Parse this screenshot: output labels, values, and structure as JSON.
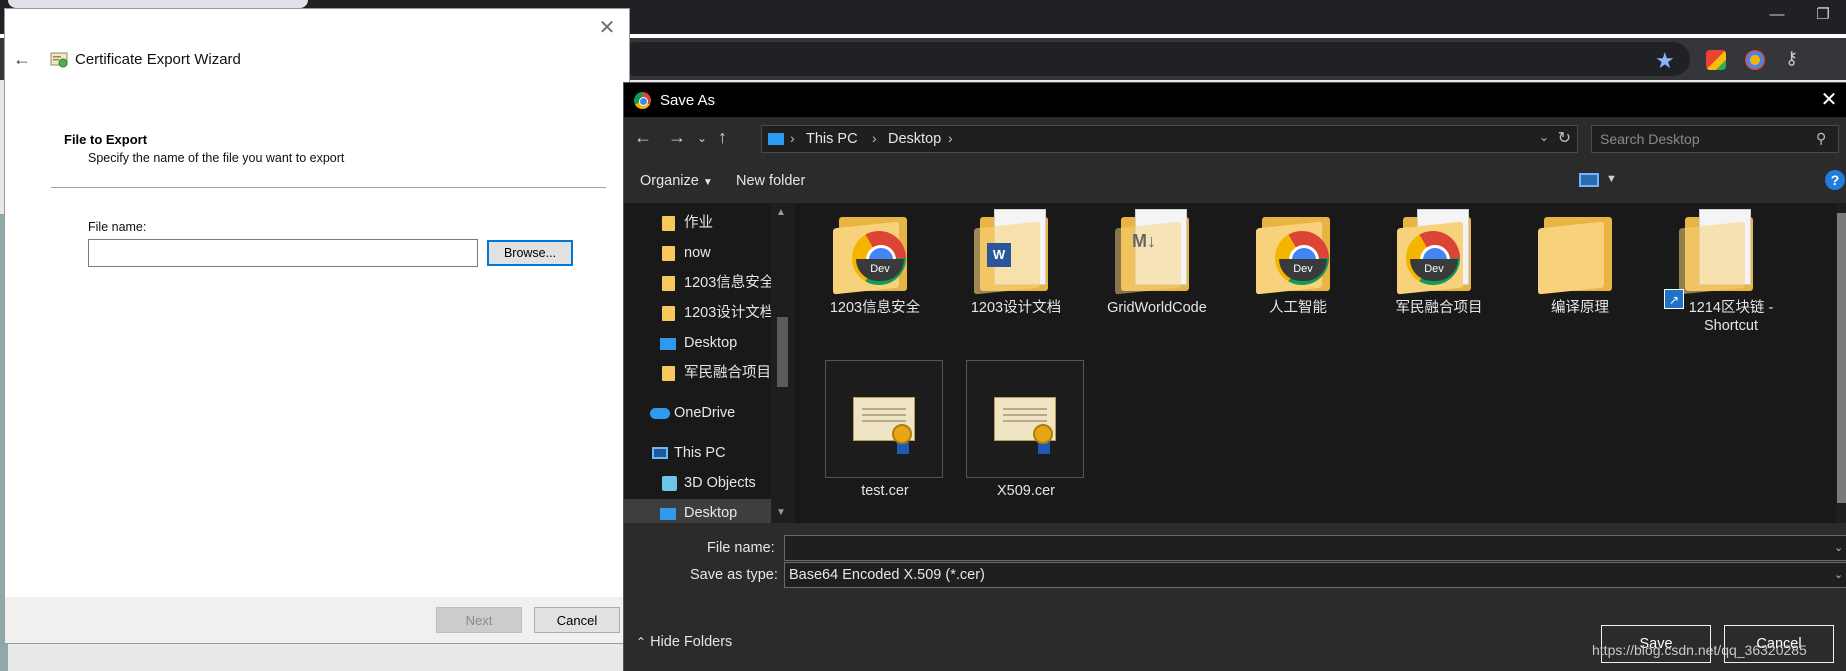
{
  "wizard": {
    "title": "Certificate Export Wizard",
    "heading": "File to Export",
    "subheading": "Specify the name of the file you want to export",
    "file_name_label": "File name:",
    "file_name_value": "",
    "browse_label": "Browse...",
    "next_label": "Next",
    "cancel_label": "Cancel"
  },
  "save_as": {
    "title": "Save As",
    "breadcrumb": [
      "This PC",
      "Desktop"
    ],
    "search_placeholder": "Search Desktop",
    "organize_label": "Organize",
    "new_folder_label": "New folder",
    "sidebar": [
      {
        "label": "作业",
        "icon": "folder-icon",
        "pinned": true
      },
      {
        "label": "now",
        "icon": "folder-icon",
        "pinned": true
      },
      {
        "label": "1203信息安全",
        "icon": "folder-icon"
      },
      {
        "label": "1203设计文档",
        "icon": "folder-icon"
      },
      {
        "label": "Desktop",
        "icon": "desktop-icon"
      },
      {
        "label": "军民融合项目",
        "icon": "folder-icon"
      },
      {
        "label": "OneDrive",
        "icon": "onedrive-icon"
      },
      {
        "label": "This PC",
        "icon": "this-pc-icon"
      },
      {
        "label": "3D Objects",
        "icon": "3d-objects-icon"
      },
      {
        "label": "Desktop",
        "icon": "desktop-icon",
        "selected": true
      }
    ],
    "files": [
      {
        "name": "1203信息安全",
        "kind": "folder-chrome-dev"
      },
      {
        "name": "1203设计文档",
        "kind": "folder-word"
      },
      {
        "name": "GridWorldCode",
        "kind": "folder-markdown"
      },
      {
        "name": "人工智能",
        "kind": "folder-chrome-dev"
      },
      {
        "name": "军民融合项目",
        "kind": "folder-chrome-dev"
      },
      {
        "name": "编译原理",
        "kind": "folder-empty"
      },
      {
        "name": "1214区块链 - Shortcut",
        "kind": "folder-shortcut"
      },
      {
        "name": "test.cer",
        "kind": "certificate"
      },
      {
        "name": "X509.cer",
        "kind": "certificate"
      }
    ],
    "file_name_label": "File name:",
    "file_name_value": "",
    "save_type_label": "Save as type:",
    "save_type_value": "Base64 Encoded X.509 (*.cer)",
    "hide_folders_label": "Hide Folders",
    "save_label": "Save",
    "cancel_label": "Cancel"
  },
  "watermark": "https://blog.csdn.net/qq_36320285",
  "colors": {
    "dialog_dark": "#2b2b2b",
    "pane_dark": "#191919",
    "accent_blue": "#0078d7",
    "folder_yellow": "#f7d27a"
  }
}
